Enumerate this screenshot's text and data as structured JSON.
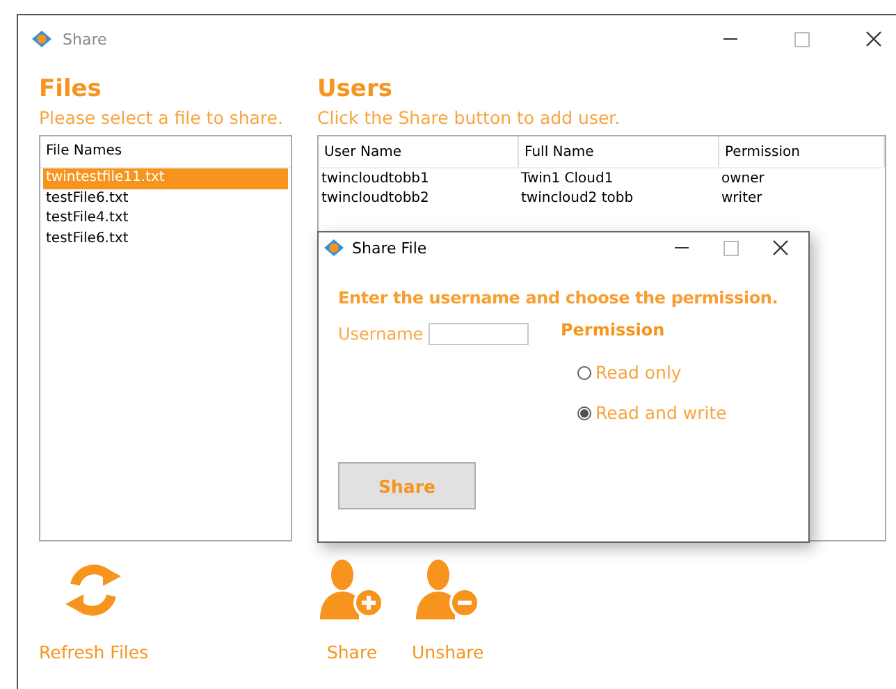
{
  "window": {
    "title": "Share"
  },
  "files": {
    "heading": "Files",
    "hint": "Please select a file to share.",
    "column": "File Names",
    "items": [
      {
        "name": "twintestfile11.txt",
        "selected": true
      },
      {
        "name": "testFile6.txt",
        "selected": false
      },
      {
        "name": "testFile4.txt",
        "selected": false
      },
      {
        "name": "testFile6.txt",
        "selected": false
      }
    ],
    "action": {
      "kind": "refresh",
      "label": "Refresh Files"
    }
  },
  "users": {
    "heading": "Users",
    "hint": "Click the Share button to add user.",
    "columns": [
      "User Name",
      "Full Name",
      "Permission"
    ],
    "rows": [
      [
        "twincloudtobb1",
        "Twin1 Cloud1",
        "owner"
      ],
      [
        "twincloudtobb2",
        "twincloud2 tobb",
        "writer"
      ]
    ],
    "actions": [
      {
        "kind": "add",
        "label": "Share"
      },
      {
        "kind": "remove",
        "label": "Unshare"
      }
    ]
  },
  "dialog": {
    "title": "Share File",
    "prompt": "Enter the username and choose the permission.",
    "username_label": "Username",
    "permission_label": "Permission",
    "options": [
      {
        "label": "Read only",
        "selected": false
      },
      {
        "label": "Read and write",
        "selected": true
      }
    ],
    "button": "Share"
  }
}
